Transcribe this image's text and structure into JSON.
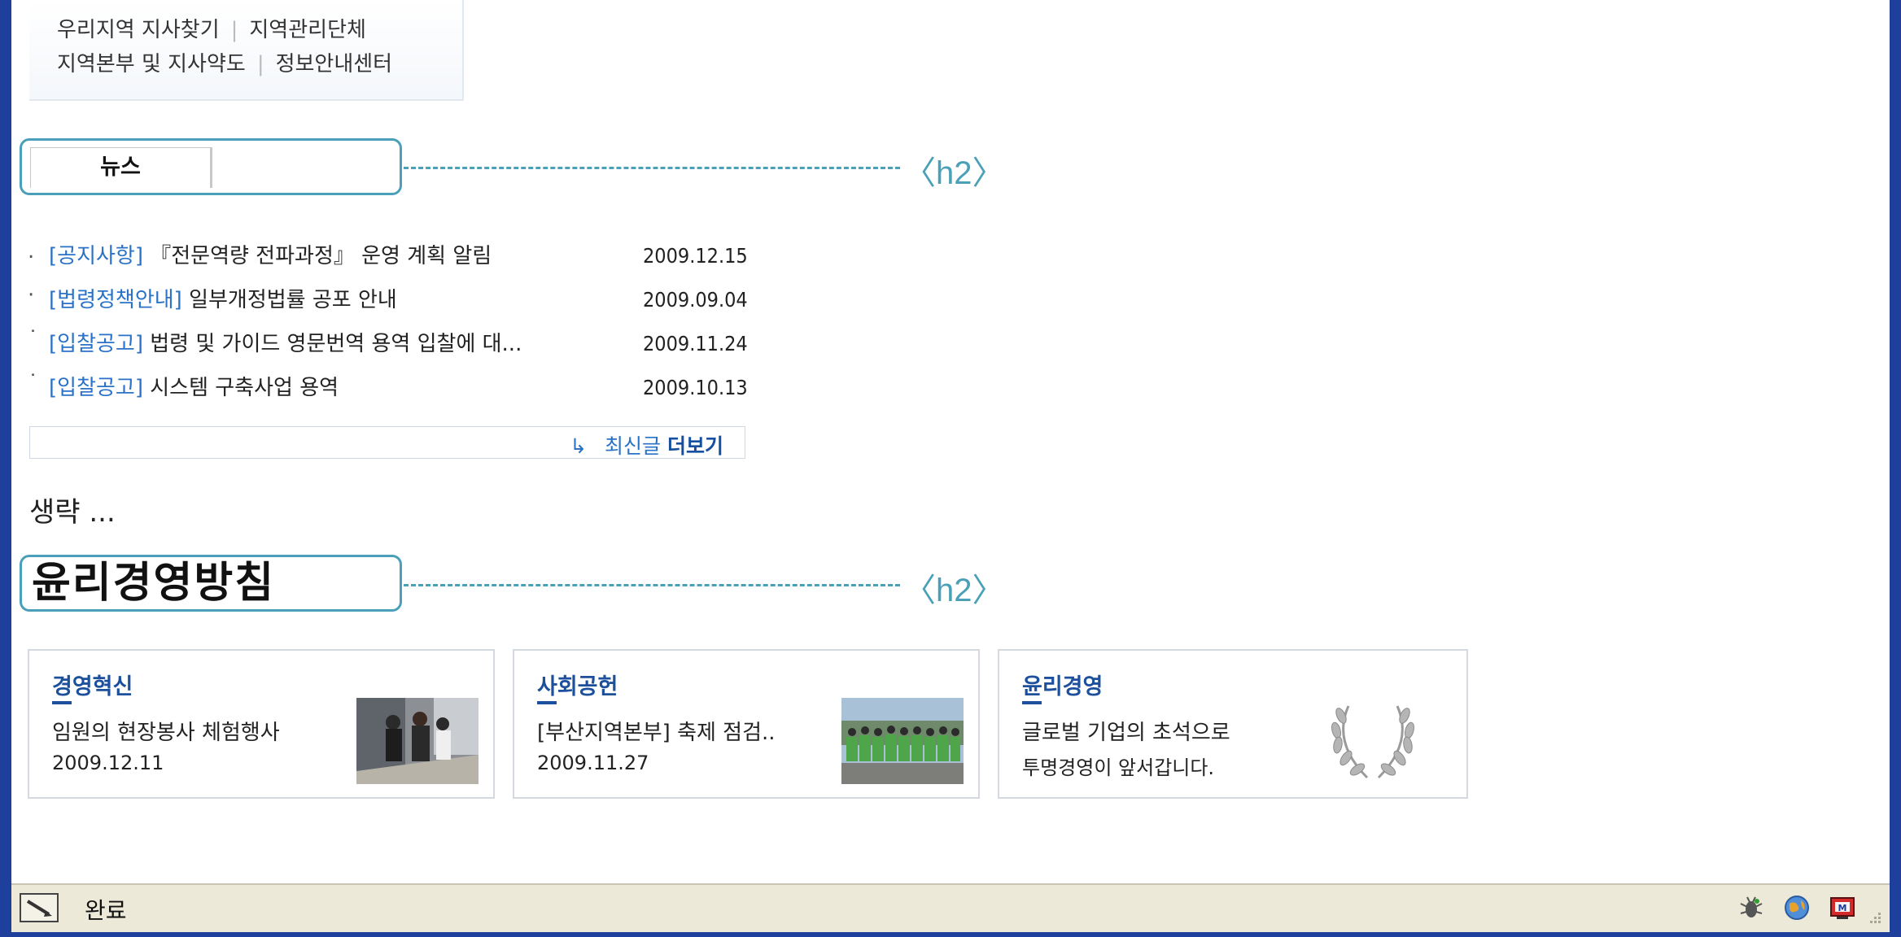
{
  "top_links": {
    "row1": [
      "우리지역 지사찾기",
      "지역관리단체"
    ],
    "row2": [
      "지역본부 및 지사약도",
      "정보안내센터"
    ]
  },
  "news_section": {
    "tab_label": "뉴스",
    "h2_annotation": "〈h2〉",
    "items": [
      {
        "bullet": ".",
        "category": "[공지사항]",
        "title": "『전문역량 전파과정』 운영 계획 알림",
        "date": "2009.12.15"
      },
      {
        "bullet": "·",
        "category": "[법령정책안내]",
        "title": "일부개정법률 공포 안내",
        "date": "2009.09.04"
      },
      {
        "bullet": "˙",
        "category": "[입찰공고]",
        "title": "법령 및 가이드 영문번역 용역 입찰에 대...",
        "date": "2009.11.24"
      },
      {
        "bullet": "˙",
        "category": "[입찰공고]",
        "title": "시스템 구축사업 용역",
        "date": "2009.10.13"
      }
    ],
    "more_arrow": "↳",
    "more_prefix": "최신글",
    "more_bold": "더보기"
  },
  "omitted_text": "생략 ...",
  "ethics_section": {
    "title": "윤리경영방침",
    "h2_annotation": "〈h2〉",
    "cards": [
      {
        "title": "경영혁신",
        "line1": "임원의 현장봉사 체험행사",
        "line2": "2009.12.11",
        "image": "volunteer-photo"
      },
      {
        "title": "사회공헌",
        "line1": "[부산지역본부] 축제 점검..",
        "line2": "2009.11.27",
        "image": "group-photo"
      },
      {
        "title": "윤리경영",
        "line1": "글로벌 기업의 초석으로",
        "line2": "투명경영이 앞서갑니다.",
        "image": "laurel-wreath"
      }
    ]
  },
  "statusbar": {
    "status": "완료",
    "icons": [
      "page-status-icon",
      "bug-icon",
      "globe-icon",
      "tv-icon",
      "resize-grip-icon"
    ]
  },
  "colors": {
    "frame": "#1e3f9c",
    "callout": "#4aa0b8",
    "link_blue": "#2a72c8",
    "card_title": "#1c4f9c",
    "statusbar": "#ece9d8"
  }
}
